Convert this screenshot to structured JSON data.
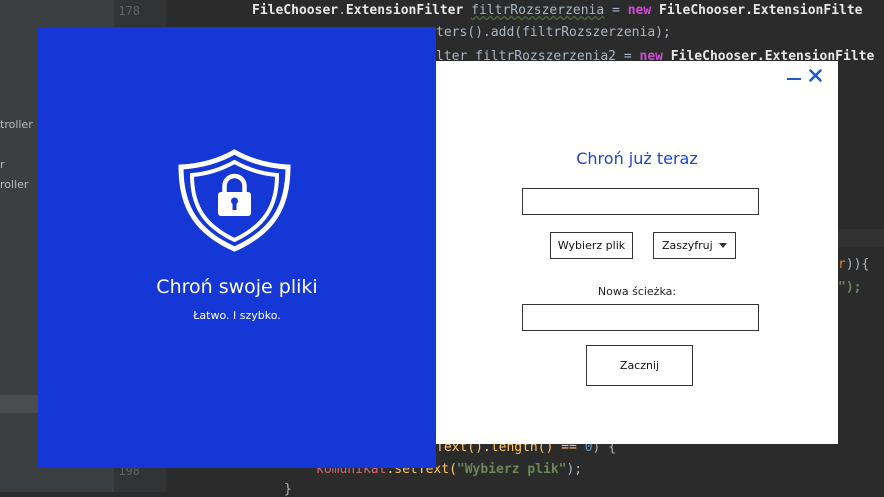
{
  "ide": {
    "sidebar_items": [
      "troller",
      "r",
      "roller"
    ],
    "line_numbers": {
      "top": "178",
      "bottom": "198"
    },
    "code": {
      "line1_type": "FileChooser",
      "line1_dot1": ".",
      "line1_ext": "ExtensionFilter",
      "line1_var": "filtrRozszerzenia",
      "line1_eq": " = ",
      "line1_new": "new",
      "line1_type2": " FileChooser.ExtensionFilte",
      "line2": "ters().add(filtrRozszerzenia);",
      "line3_a": "lter filtrRozszerzenia2 = ",
      "line3_new": "new",
      "line3_b": " FileChooser.ExtensionFilte",
      "right_a": "r",
      "right_b": ")){",
      "right_c": "\");",
      "line_text": "Text().length() == ",
      "line_zero": "0",
      "line_brace": ") {",
      "line_kom": "komunikat",
      "line_set": ".setText(",
      "line_str": "\"Wybierz plik\"",
      "line_end": ");",
      "line_last": "}"
    }
  },
  "promo": {
    "title": "Chroń swoje pliki",
    "subtitle": "Łatwo. I szybko."
  },
  "form": {
    "title": "Chroń już teraz",
    "file_field_value": "",
    "choose_button_label": "Wybierz plik",
    "mode_select_value": "Zaszyfruj",
    "path_label": "Nowa ścieżka:",
    "path_field_value": "",
    "start_button_label": "Zacznij"
  },
  "colors": {
    "promo_background": "#1537d6",
    "form_title": "#1f43cf",
    "window_controls": "#1f5bc7"
  },
  "icons": {
    "promo": "shield-lock-icon",
    "minimize": "minimize-icon",
    "close": "close-icon",
    "select": "chevron-down-icon"
  }
}
